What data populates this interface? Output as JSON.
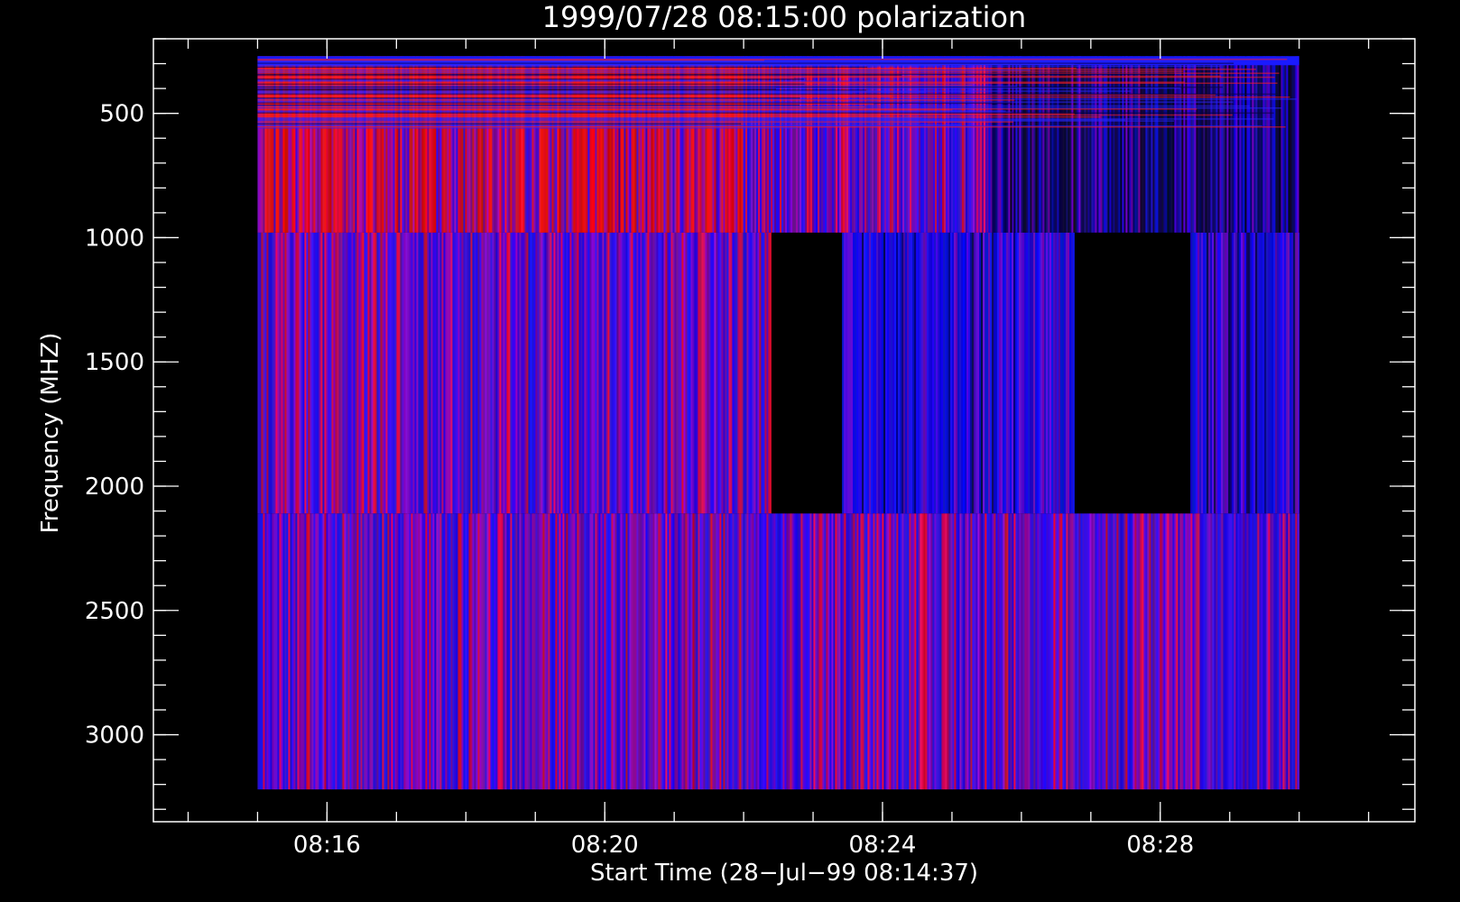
{
  "chart_data": {
    "type": "heatmap",
    "title": "1999/07/28 08:15:00 polarization",
    "xlabel": "Start Time (28−Jul−99 08:14:37)",
    "ylabel": "Frequency (MHZ)",
    "x_axis": {
      "unit": "minutes",
      "range": [
        "08:13:30",
        "08:31:40"
      ],
      "major_ticks": [
        "08:16",
        "08:20",
        "08:24",
        "08:28"
      ],
      "minor_tick_step_minutes": 1
    },
    "y_axis": {
      "unit": "MHz",
      "inverted": true,
      "range": [
        200,
        3350
      ],
      "major_ticks": [
        500,
        1000,
        1500,
        2000,
        2500,
        3000
      ],
      "minor_tick_step": 100
    },
    "data_time_range": [
      "08:15:00",
      "08:30:00"
    ],
    "data_freq_range": [
      270,
      3220
    ],
    "colormap": {
      "low": "#000000",
      "mid": "#2020ff",
      "high": "#ff1a1a"
    },
    "bands": [
      {
        "name": "low",
        "freq_range": [
          270,
          980
        ],
        "texture": "fine horizontal striping above 560 MHz, vertical striping below",
        "segments": [
          {
            "time_range": [
              "08:15:00",
              "08:22:00"
            ],
            "level": "red"
          },
          {
            "time_range": [
              "08:22:00",
              "08:25:30"
            ],
            "level": "blue-purple"
          },
          {
            "time_range": [
              "08:25:30",
              "08:30:00"
            ],
            "level": "dark-blue"
          }
        ]
      },
      {
        "name": "mid",
        "freq_range": [
          980,
          2110
        ],
        "segments": [
          {
            "time_range": [
              "08:15:00",
              "08:22:24"
            ],
            "level": "blue-purple"
          },
          {
            "time_range": [
              "08:22:24",
              "08:23:25"
            ],
            "level": "no-data"
          },
          {
            "time_range": [
              "08:23:25",
              "08:26:46"
            ],
            "level": "blue"
          },
          {
            "time_range": [
              "08:26:46",
              "08:28:26"
            ],
            "level": "no-data"
          },
          {
            "time_range": [
              "08:28:26",
              "08:30:00"
            ],
            "level": "blue"
          }
        ]
      },
      {
        "name": "high",
        "freq_range": [
          2110,
          3220
        ],
        "segments": [
          {
            "time_range": [
              "08:15:00",
              "08:30:00"
            ],
            "level": "blue-purple"
          }
        ]
      }
    ],
    "grid": false
  }
}
